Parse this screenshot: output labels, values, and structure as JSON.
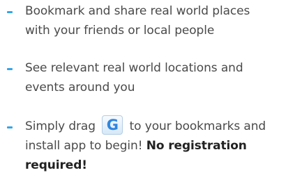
{
  "colors": {
    "bullet": "#33a5e8",
    "text": "#4a4a4a",
    "g_icon": "#2f86de"
  },
  "features": [
    {
      "lines": [
        "Bookmark and share real world places",
        "with your friends or local people"
      ]
    },
    {
      "lines": [
        "See relevant real world locations and",
        "events around you"
      ]
    },
    {
      "line1_before": "Simply drag",
      "g_icon": "G",
      "line1_after": "to your bookmarks and",
      "line2_plain": "install app to begin!",
      "line2_bold": "No registration",
      "line3_bold": "required!"
    }
  ]
}
